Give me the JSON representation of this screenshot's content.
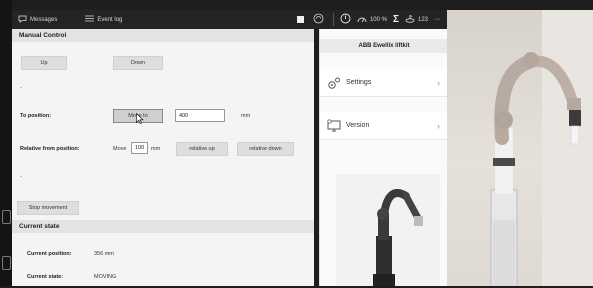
{
  "topbar": {
    "messages_label": "Messages",
    "eventlog_label": "Event log",
    "speed": "100 %",
    "counter": "123",
    "more": "···"
  },
  "manual_control": {
    "header": "Manual Control",
    "up_label": "Up",
    "down_label": "Down",
    "dash1": "-",
    "to_position_label": "To position:",
    "move_to_label": "Move to",
    "target_value": "400",
    "target_unit": "mm",
    "relative_label": "Relative from position:",
    "move_word": "Move",
    "relative_value": "100",
    "relative_unit": "mm",
    "relative_up_label": "relative up",
    "relative_down_label": "relative down",
    "dash2": "-",
    "stop_label": "Stop movement"
  },
  "current_state": {
    "header": "Current state",
    "position_label": "Current position:",
    "position_value": "356 mm",
    "state_label": "Current state:",
    "state_value": "MOVING"
  },
  "side_panel": {
    "title": "ABB Ewellix liftkit",
    "items": [
      {
        "label": "Settings",
        "icon": "gears-icon"
      },
      {
        "label": "Version",
        "icon": "monitor-info-icon"
      }
    ]
  },
  "colors": {
    "topbar_bg": "#242424",
    "panel_bg": "#f4f4f4",
    "header_bg": "#e3e3e3",
    "button_bg": "#dedede"
  }
}
